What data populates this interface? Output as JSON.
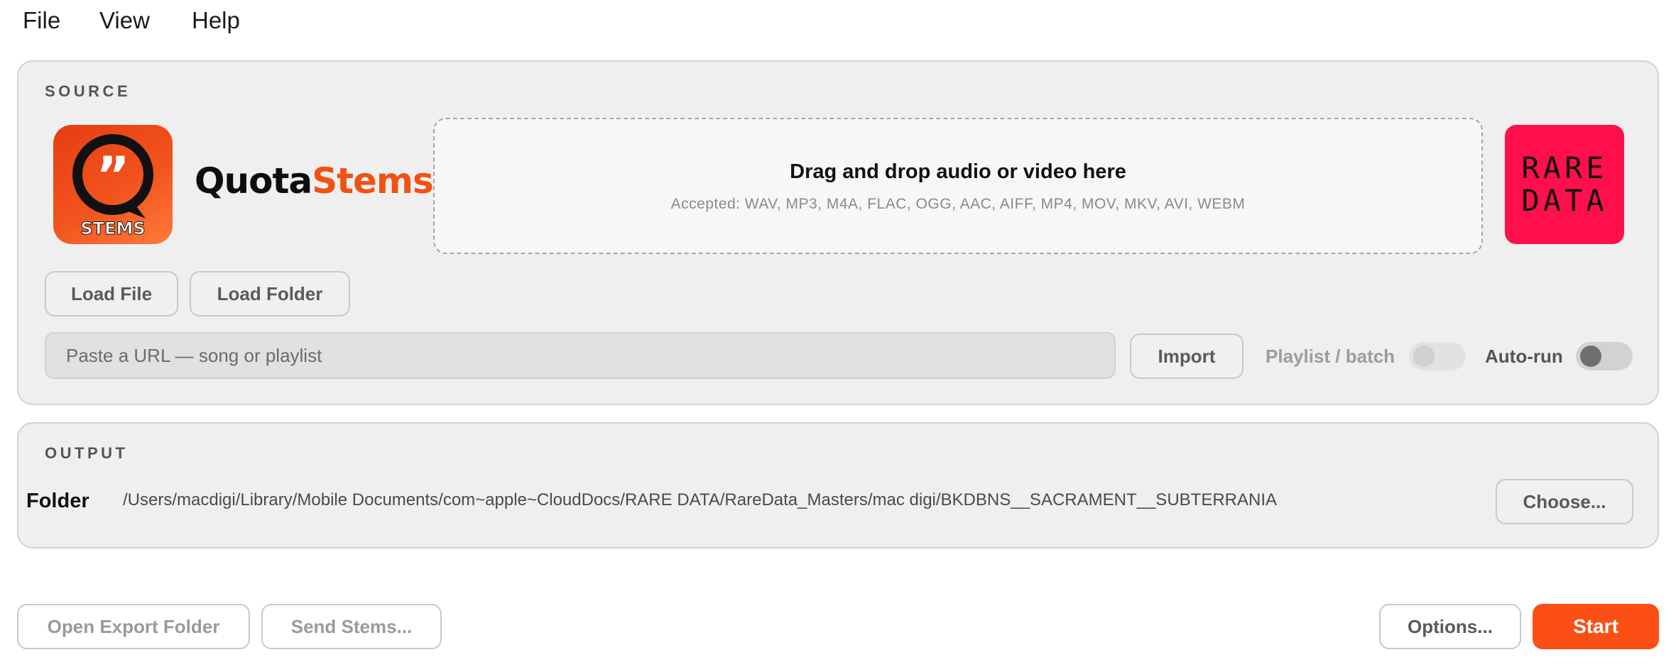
{
  "menu": [
    "File",
    "View",
    "Help"
  ],
  "source": {
    "label": "SOURCE",
    "app_logo_text": "STEMS",
    "brand_part1": "Quota",
    "brand_part2": "Stems",
    "drop_title": "Drag and drop audio or video here",
    "drop_accepted": "Accepted: WAV, MP3, M4A, FLAC, OGG, AAC, AIFF, MP4, MOV, MKV, AVI, WEBM",
    "rare_line1": "RARE",
    "rare_line2": "DATA",
    "load_file": "Load File",
    "load_folder": "Load Folder",
    "url_placeholder": "Paste a URL — song or playlist",
    "import": "Import",
    "playlist_label": "Playlist / batch",
    "playlist_on": false,
    "autorun_label": "Auto-run",
    "autorun_on": false
  },
  "output": {
    "label": "OUTPUT",
    "folder_label": "Folder",
    "folder_path": "/Users/macdigi/Library/Mobile Documents/com~apple~CloudDocs/RARE DATA/RareData_Masters/mac digi/BKDBNS__SACRAMENT__SUBTERRANIA",
    "choose": "Choose..."
  },
  "footer": {
    "open_export": "Open Export Folder",
    "send_stems": "Send Stems...",
    "options": "Options...",
    "start": "Start"
  },
  "colors": {
    "accent": "#fc4f16",
    "rare_logo_bg": "#ff0f4b",
    "panel_bg": "#efefef"
  }
}
